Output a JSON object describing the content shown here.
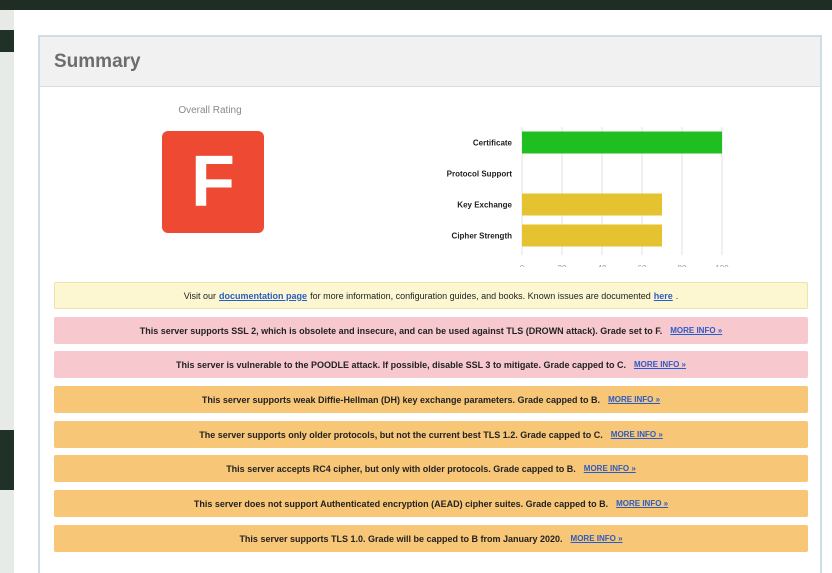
{
  "panel": {
    "title": "Summary",
    "rating_label": "Overall Rating",
    "grade": "F"
  },
  "chart_data": {
    "type": "bar",
    "orientation": "horizontal",
    "categories": [
      "Certificate",
      "Protocol Support",
      "Key Exchange",
      "Cipher Strength"
    ],
    "values": [
      100,
      0,
      70,
      70
    ],
    "colors": [
      "#1fbf21",
      "#1fbf21",
      "#e5c230",
      "#e5c230"
    ],
    "xlim": [
      0,
      100
    ],
    "xticks": [
      "0",
      "20",
      "40",
      "60",
      "80",
      "100"
    ],
    "grid": true
  },
  "notices": [
    {
      "type": "info",
      "pre": "Visit our",
      "link1": "documentation page",
      "mid": "for more information, configuration guides, and books. Known issues are documented",
      "link2": "here",
      "post": "."
    },
    {
      "type": "red",
      "text": "This server supports SSL 2, which is obsolete and insecure, and can be used against TLS (DROWN attack). Grade set to F.",
      "link": "MORE INFO »"
    },
    {
      "type": "red",
      "text": "This server is vulnerable to the POODLE attack. If possible, disable SSL 3 to mitigate. Grade capped to C.",
      "link": "MORE INFO »"
    },
    {
      "type": "orange",
      "text": "This server supports weak Diffie-Hellman (DH) key exchange parameters. Grade capped to B.",
      "link": "MORE INFO »"
    },
    {
      "type": "orange",
      "text": "The server supports only older protocols, but not the current best TLS 1.2. Grade capped to C.",
      "link": "MORE INFO »"
    },
    {
      "type": "orange",
      "text": "This server accepts RC4 cipher, but only with older protocols. Grade capped to B.",
      "link": "MORE INFO »"
    },
    {
      "type": "orange",
      "text": "This server does not support Authenticated encryption (AEAD) cipher suites. Grade capped to B.",
      "link": "MORE INFO »"
    },
    {
      "type": "orange",
      "text": "This server supports TLS 1.0. Grade will be capped to B from January 2020.",
      "link": "MORE INFO »"
    }
  ],
  "colors": {
    "grade_bg": "#ee4a33",
    "good_bar": "#1fbf21",
    "warn_bar": "#e5c230",
    "notice_red": "#f7c9cf",
    "notice_orange": "#f7c676",
    "notice_info": "#fcf7d0",
    "link": "#2a5cc5"
  }
}
